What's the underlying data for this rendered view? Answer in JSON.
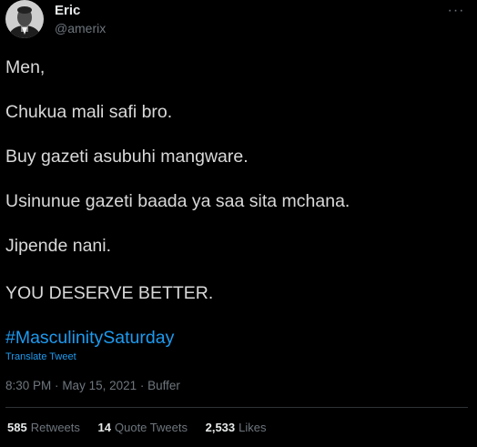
{
  "author": {
    "display_name": "Eric",
    "handle": "@amerix"
  },
  "tweet": {
    "lines": [
      "Men,",
      "Chukua mali safi bro.",
      "Buy gazeti asubuhi mangware.",
      "Usinunue gazeti baada ya saa sita mchana.",
      "Jipende nani.",
      "YOU DESERVE BETTER."
    ],
    "hashtag": "#MasculinitySaturday",
    "translate_label": "Translate Tweet",
    "time": "8:30 PM",
    "date": "May 15, 2021",
    "source": "Buffer",
    "separator": "·"
  },
  "stats": {
    "retweets_count": "585",
    "retweets_label": "Retweets",
    "quotes_count": "14",
    "quotes_label": "Quote Tweets",
    "likes_count": "2,533",
    "likes_label": "Likes"
  },
  "icons": {
    "more": "more-horizontal-icon"
  },
  "colors": {
    "background": "#000000",
    "text": "#d9d9d9",
    "secondary": "#6e767d",
    "link": "#1d9bf0",
    "divider": "#2f3336"
  }
}
